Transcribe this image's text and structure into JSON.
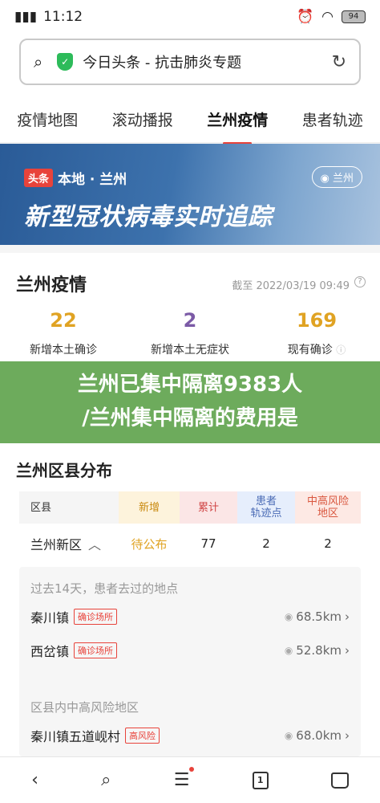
{
  "status": {
    "time": "11:12",
    "battery": "94"
  },
  "search": {
    "query": "今日头条 - 抗击肺炎专题"
  },
  "tabs": [
    "疫情地图",
    "滚动播报",
    "兰州疫情",
    "患者轨迹"
  ],
  "banner": {
    "brand": "头条",
    "local": "本地 · 兰州",
    "location": "兰州",
    "headline": "新型冠状病毒实时追踪"
  },
  "summary": {
    "title": "兰州疫情",
    "updated": "截至 2022/03/19 09:49",
    "stats": [
      {
        "value": "22",
        "label": "新增本土确诊",
        "color": "#e0a323"
      },
      {
        "value": "2",
        "label": "新增本土无症状",
        "color": "#7b5aa6"
      },
      {
        "value": "169",
        "label": "现有确诊",
        "color": "#e0a323"
      }
    ]
  },
  "overlay": {
    "line1": "兰州已集中隔离9383人",
    "line2": "/兰州集中隔离的费用是"
  },
  "district": {
    "title": "兰州区县分布",
    "headers": [
      "区县",
      "新增",
      "累计",
      "患者\n轨迹点",
      "中高风险\n地区"
    ],
    "header_colors": [
      "#f5f5f5",
      "#fdf3dc",
      "#fbe6e6",
      "#e6eefc",
      "#fde9e4"
    ],
    "row": {
      "name": "兰州新区",
      "new": "待公布",
      "total": "77",
      "track": "2",
      "risk": "2"
    },
    "recent_title": "过去14天，患者去过的地点",
    "recent": [
      {
        "name": "秦川镇",
        "tag": "确诊场所",
        "distance": "68.5km"
      },
      {
        "name": "西岔镇",
        "tag": "确诊场所",
        "distance": "52.8km"
      }
    ],
    "risk_title": "区县内中高风险地区",
    "risk": [
      {
        "name": "秦川镇五道岘村",
        "tag": "高风险",
        "distance": "68.0km"
      }
    ]
  }
}
